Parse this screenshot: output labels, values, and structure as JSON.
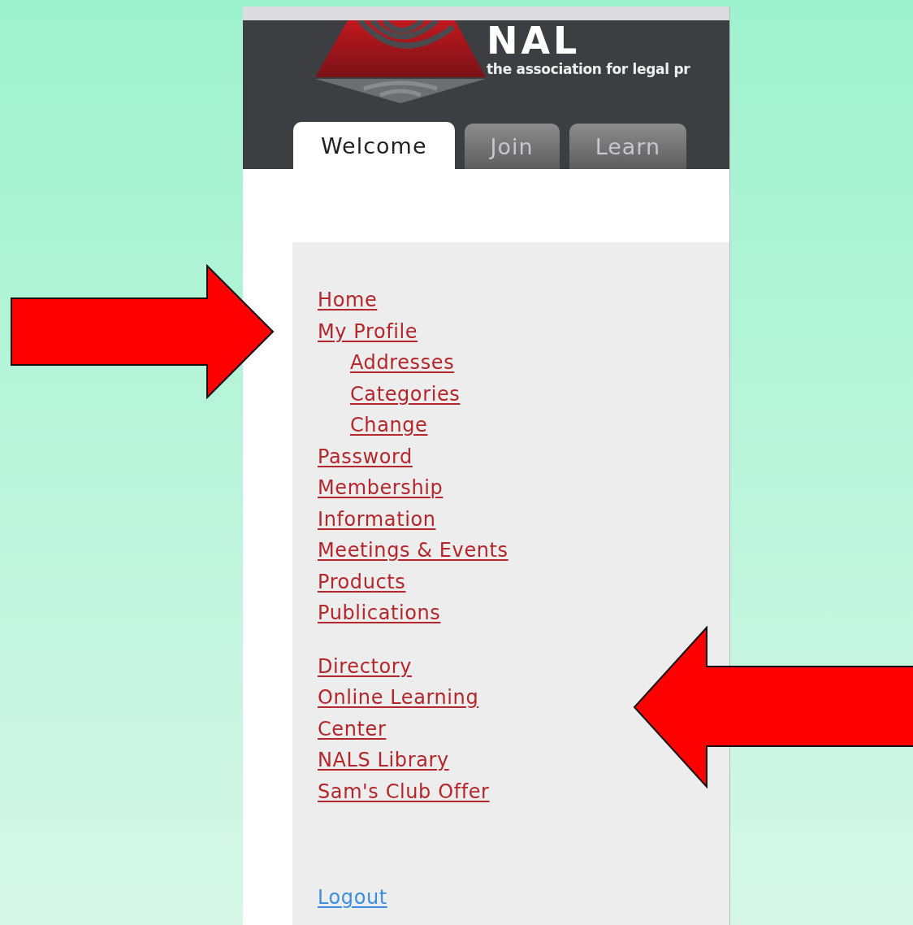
{
  "header": {
    "logo_text": "NAL",
    "tagline": "the association for legal pr"
  },
  "tabs": [
    {
      "label": "Welcome",
      "selected": true
    },
    {
      "label": "Join",
      "selected": false
    },
    {
      "label": "Learn",
      "selected": false
    }
  ],
  "menu": {
    "groups": [
      {
        "items": [
          {
            "label": "Home"
          },
          {
            "label": "My Profile",
            "children": [
              {
                "label": "Addresses"
              },
              {
                "label": "Categories"
              },
              {
                "label": "Change"
              }
            ]
          },
          {
            "label": "Password"
          },
          {
            "label": "Membership"
          },
          {
            "label": "Information"
          },
          {
            "label": "Meetings & Events"
          },
          {
            "label": "Products"
          },
          {
            "label": "Publications"
          }
        ]
      },
      {
        "items": [
          {
            "label": "Directory"
          },
          {
            "label": "Online Learning"
          },
          {
            "label": "Center"
          },
          {
            "label": "NALS Library"
          },
          {
            "label": "Sam's Club Offer"
          }
        ]
      }
    ],
    "logout": "Logout"
  }
}
